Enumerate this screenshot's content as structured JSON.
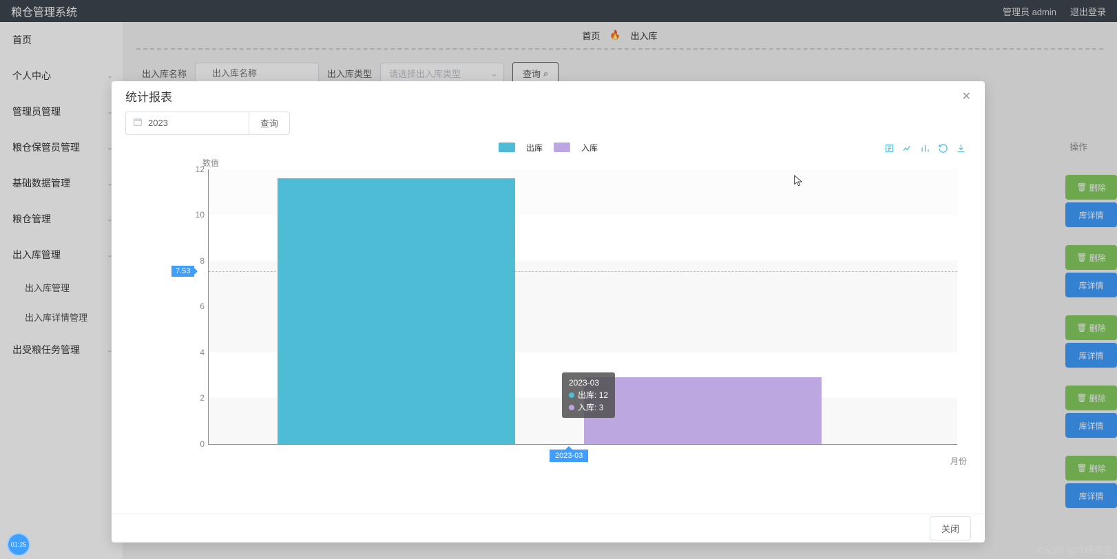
{
  "app_title": "粮仓管理系统",
  "header": {
    "user": "管理员 admin",
    "logout": "退出登录"
  },
  "sidebar": {
    "items": [
      {
        "label": "首页"
      },
      {
        "label": "个人中心"
      },
      {
        "label": "管理员管理"
      },
      {
        "label": "粮仓保管员管理"
      },
      {
        "label": "基础数据管理"
      },
      {
        "label": "粮仓管理"
      },
      {
        "label": "出入库管理"
      },
      {
        "label": "出入库管理",
        "sub": true
      },
      {
        "label": "出入库详情管理",
        "sub": true
      },
      {
        "label": "出受粮任务管理"
      }
    ]
  },
  "breadcrumb": {
    "home": "首页",
    "page": "出入库"
  },
  "filter": {
    "name_label": "出入库名称",
    "name_placeholder": "出入库名称",
    "type_label": "出入库类型",
    "type_placeholder": "请选择出入库类型",
    "search": "查询"
  },
  "actions": {
    "header": "操作",
    "delete": "删除",
    "detail": "库详情"
  },
  "modal": {
    "title": "统计报表",
    "year": "2023",
    "query": "查询",
    "close": "关闭"
  },
  "chart_data": {
    "type": "bar",
    "title": "",
    "ylabel": "数值",
    "xlabel": "月份",
    "ylim": [
      0,
      12
    ],
    "yticks": [
      0,
      2,
      4,
      6,
      8,
      10,
      12
    ],
    "y_marker": 7.53,
    "categories": [
      "2023-03"
    ],
    "series": [
      {
        "name": "出库",
        "color": "#4ebcd5",
        "values": [
          12
        ]
      },
      {
        "name": "入库",
        "color": "#bda7e0",
        "values": [
          3
        ]
      }
    ],
    "tooltip": {
      "category": "2023-03",
      "rows": [
        {
          "name": "出库",
          "value": 12
        },
        {
          "name": "入库",
          "value": 3
        }
      ]
    }
  },
  "toolbox": [
    "data-view",
    "line-switch",
    "bar-switch",
    "restore",
    "save-image"
  ],
  "watermark": "CSDN @IT研究室",
  "videotime": "01:25"
}
